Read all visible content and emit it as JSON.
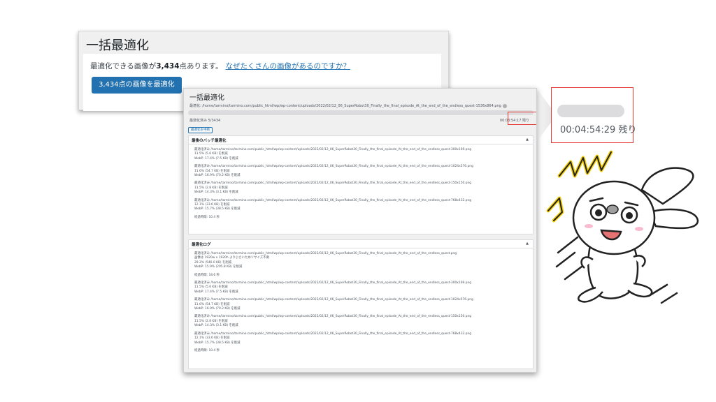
{
  "bulk_panel": {
    "title": "一括最適化",
    "count_text_pre": "最適化できる画像が",
    "count_value": "3,434",
    "count_text_post": "点あります。",
    "help_link": "なぜたくさんの画像があるのですか？",
    "optimize_button": "3,434点の画像を最適化"
  },
  "progress_panel": {
    "title": "一括最適化",
    "current_path": "最適化: /home/tarmino/tarmino.com/public_html/wp/wp-content/uploads/2022/02/12_06_SuperRobot30_Finally_the_final_episode_At_the_end_of_the_endless_quest-1536x864.png",
    "optimized_count": "最適化済み 5/3434",
    "remaining_small": "00:03:54:17 残り",
    "stop_button": "最適化を中断",
    "last_batch": {
      "header": "最後のバッチ最適化",
      "entries": [
        {
          "path": "最適化済み /home/tarmino/tarmino.com/public_html/wp/wp-content/uploads/2022/02/12_06_SuperRobot30_Finally_the_final_episode_At_the_end_of_the_endless_quest-300x169.png",
          "line1": "11.5% (5.6 KB) を削減",
          "line2": "WebP: 17.4% (7.5 KB) を削減"
        },
        {
          "path": "最適化済み /home/tarmino/tarmino.com/public_html/wp/wp-content/uploads/2022/02/12_06_SuperRobot30_Finally_the_final_episode_At_the_end_of_the_endless_quest-1024x576.png",
          "line1": "11.6% (54.7 KB) を削減",
          "line2": "WebP: 16.9% (70.2 KB) を削減"
        },
        {
          "path": "最適化済み /home/tarmino/tarmino.com/public_html/wp/wp-content/uploads/2022/02/12_06_SuperRobot30_Finally_the_final_episode_At_the_end_of_the_endless_quest-150x150.png",
          "line1": "11.5% (2.8 KB) を削減",
          "line2": "WebP: 14.3% (3.1 KB) を削減"
        },
        {
          "path": "最適化済み /home/tarmino/tarmino.com/public_html/wp/wp-content/uploads/2022/02/12_06_SuperRobot30_Finally_the_final_episode_At_the_end_of_the_endless_quest-768x432.png",
          "line1": "12.1% (33.6 KB) を削減",
          "line2": "WebP: 15.7% (38.5 KB) を削減"
        }
      ],
      "elapsed": "経過時間: 10.4 秒"
    },
    "log": {
      "header": "最適化ログ",
      "first_path": "最適化済み /home/tarmino/tarmino.com/public_html/wp/wp-content/uploads/2022/02/12_06_SuperRobot30_Finally_the_final_episode_At_the_end_of_the_endless_quest.png",
      "first_note": "画像は 1920w x 1920h より小さいためリサイズ不要",
      "first_line1": "29.2% (546.0 KB) を削減",
      "first_line2": "WebP: 15.9% (205.8 KB) を削減",
      "first_elapsed": "経過時間: 18.6 秒",
      "entries": [
        {
          "path": "最適化済み /home/tarmino/tarmino.com/public_html/wp/wp-content/uploads/2022/02/12_06_SuperRobot30_Finally_the_final_episode_At_the_end_of_the_endless_quest-300x169.png",
          "line1": "11.5% (5.6 KB) を削減",
          "line2": "WebP: 17.4% (7.5 KB) を削減"
        },
        {
          "path": "最適化済み /home/tarmino/tarmino.com/public_html/wp/wp-content/uploads/2022/02/12_06_SuperRobot30_Finally_the_final_episode_At_the_end_of_the_endless_quest-1024x576.png",
          "line1": "11.6% (54.7 KB) を削減",
          "line2": "WebP: 16.9% (70.2 KB) を削減"
        },
        {
          "path": "最適化済み /home/tarmino/tarmino.com/public_html/wp/wp-content/uploads/2022/02/12_06_SuperRobot30_Finally_the_final_episode_At_the_end_of_the_endless_quest-150x150.png",
          "line1": "11.5% (2.8 KB) を削減",
          "line2": "WebP: 14.3% (3.1 KB) を削減"
        },
        {
          "path": "最適化済み /home/tarmino/tarmino.com/public_html/wp/wp-content/uploads/2022/02/12_06_SuperRobot30_Finally_the_final_episode_At_the_end_of_the_endless_quest-768x432.png",
          "line1": "12.1% (33.6 KB) を削減",
          "line2": "WebP: 15.7% (38.5 KB) を削減"
        }
      ],
      "elapsed": "経過時間: 10.4 秒"
    }
  },
  "zoom_callout": {
    "remaining": "00:04:54:29 残り"
  },
  "colors": {
    "primary_button": "#2271b1",
    "highlight_border": "#e53935",
    "accent_yellow": "#f5d000"
  },
  "icons": [
    "gear-icon",
    "caret-up-icon"
  ]
}
